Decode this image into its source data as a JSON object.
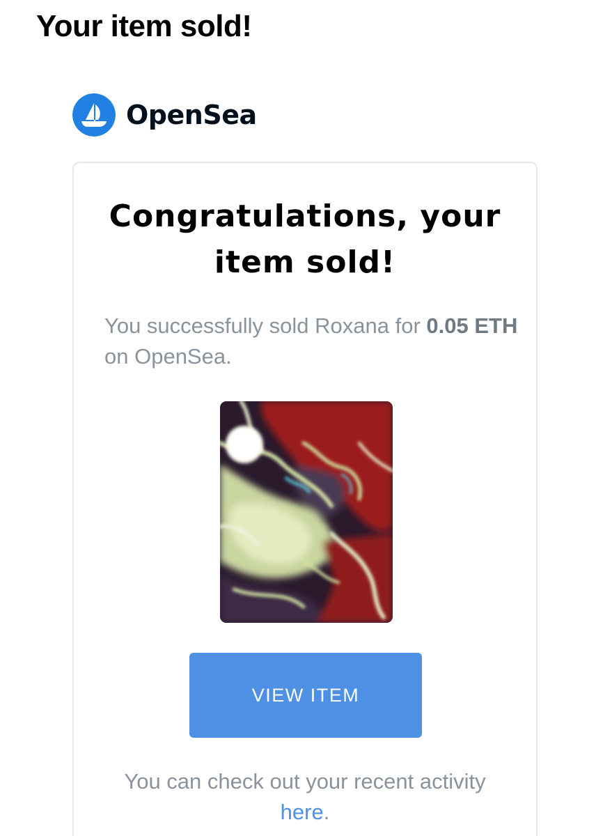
{
  "email": {
    "subject": "Your item sold!"
  },
  "brand": {
    "name": "OpenSea",
    "logo_icon": "opensea-boat-icon",
    "logo_color": "#2081e2"
  },
  "card": {
    "headline": "Congratulations, your item sold!",
    "sold_prefix": "You successfully sold Roxana for ",
    "sold_price": "0.05 ETH",
    "sold_suffix": " on OpenSea.",
    "item_image_icon": "nft-artwork-image",
    "view_button_label": "VIEW ITEM",
    "activity_prefix": "You can check out your recent activity ",
    "activity_link": "here",
    "activity_suffix": "."
  },
  "colors": {
    "button": "#4e90e4",
    "link": "#4e90e4",
    "muted_text": "#8a939b",
    "border": "#e5e8eb"
  }
}
